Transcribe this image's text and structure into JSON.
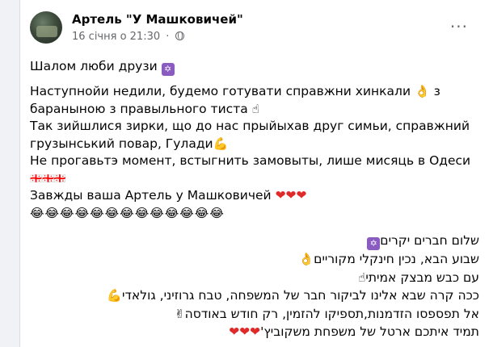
{
  "post": {
    "author": "Артель \"У Машковичей\"",
    "timestamp": "16 січня о 21:30",
    "dot": "·",
    "more": "···",
    "ua": {
      "greeting": "Шалом люби друзи",
      "greeting_emoji": "🔯",
      "line1": "Наступнойи недили, будемо готувати  справжни хинкали",
      "line1_emoji": "👌",
      "line1b": "з",
      "line2": "бараныною з правыльного тиста",
      "line2_emoji": "☝",
      "line3": "Так зийшлися зирки, що до нас прыйыхав друг симьи, справжний",
      "line4": "грузынський повар, Гулади",
      "line4_emoji": "💪",
      "line5": "Не прогавьтэ момент, встыгнить замовыты, лише мисяць в Одеси",
      "flags": "🇬🇪🇬🇪🇬🇪",
      "line6": "Завжды ваша Артель у Машковичей",
      "hearts": "❤❤❤",
      "laughs": "😂😂😂😂😂😂😂😂😂😂😂😂😂"
    },
    "he": {
      "line1": "שלום חברים יקרים",
      "line1_emoji": "🔯",
      "line2": "שבוע הבא, נכין חינקלי מקוריים",
      "line2_emoji": "👌",
      "line3": "עם כבש מבצק אמיתי",
      "line3_emoji": "☝",
      "line4": "ככה קרה שבא אלינו לביקור חבר של המשפחה, טבח גרוזיני, גולאדי",
      "line4_emoji": "💪",
      "line5": "אל תפספסו הזדמנות,תספיקו להזמין, רק חודש באודסה",
      "line5_emoji": "✌",
      "line6": "תמיד איתכם ארטל של משפחת משקוביץ'",
      "line6_hearts": "❤❤❤"
    }
  }
}
